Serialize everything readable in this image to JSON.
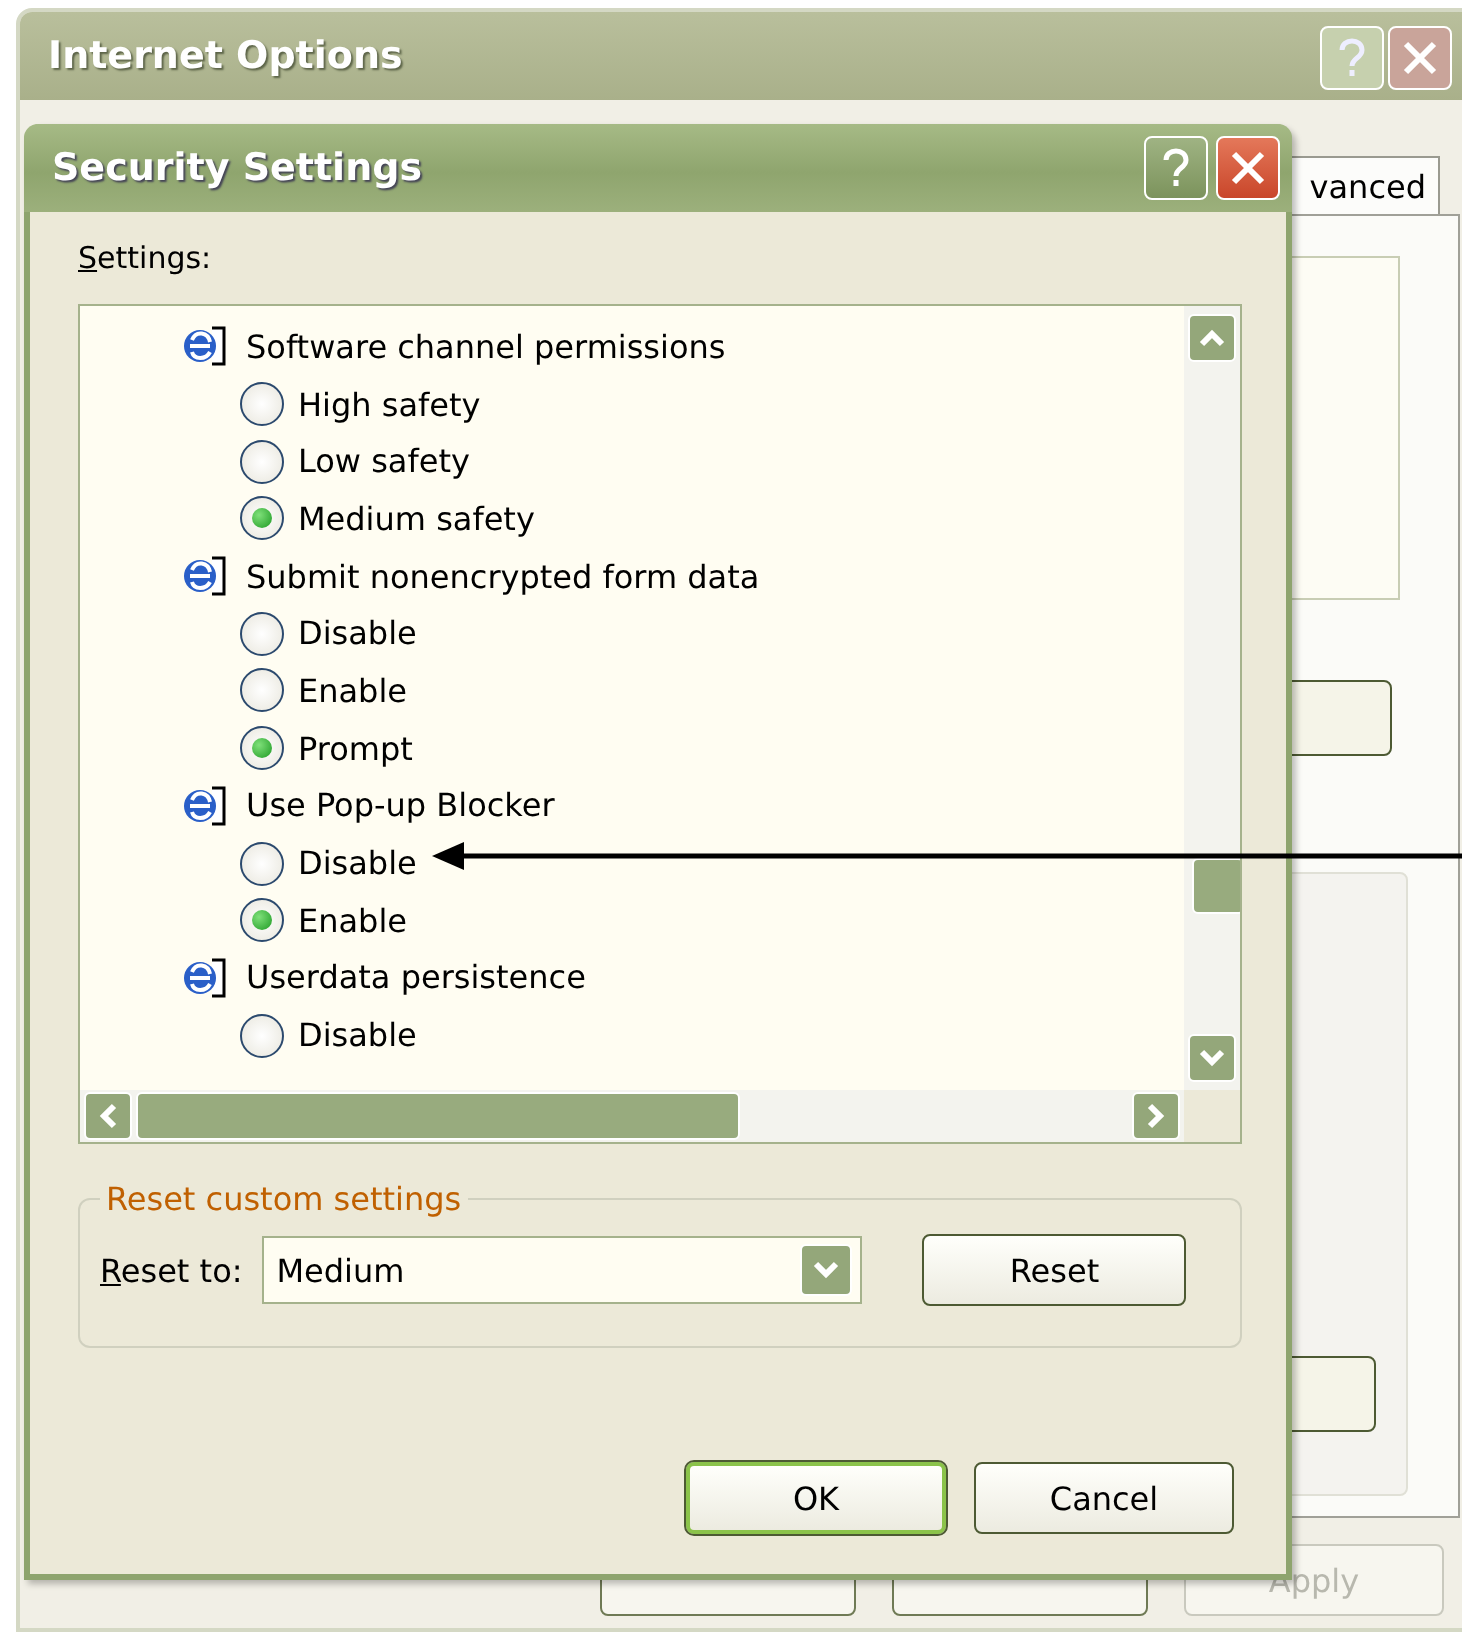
{
  "back_window": {
    "title": "Internet Options",
    "tab": {
      "label": "vanced",
      "selected": true
    },
    "apply_button": {
      "label": "Apply",
      "disabled": true
    }
  },
  "dialog": {
    "title": "Security Settings",
    "settings_label": "Settings:",
    "groups": [
      {
        "label": "Software channel permissions",
        "options": [
          {
            "label": "High safety",
            "selected": false
          },
          {
            "label": "Low safety",
            "selected": false
          },
          {
            "label": "Medium safety",
            "selected": true
          }
        ]
      },
      {
        "label": "Submit nonencrypted form data",
        "options": [
          {
            "label": "Disable",
            "selected": false
          },
          {
            "label": "Enable",
            "selected": false
          },
          {
            "label": "Prompt",
            "selected": true
          }
        ]
      },
      {
        "label": "Use Pop-up Blocker",
        "options": [
          {
            "label": "Disable",
            "selected": false
          },
          {
            "label": "Enable",
            "selected": true
          }
        ]
      },
      {
        "label": "Userdata persistence",
        "options": [
          {
            "label": "Disable",
            "selected": false
          }
        ]
      }
    ],
    "reset": {
      "legend": "Reset custom settings",
      "label": "Reset to:",
      "value": "Medium",
      "button": "Reset"
    },
    "buttons": [
      {
        "label": "OK",
        "default": true
      },
      {
        "label": "Cancel",
        "default": false
      }
    ]
  }
}
